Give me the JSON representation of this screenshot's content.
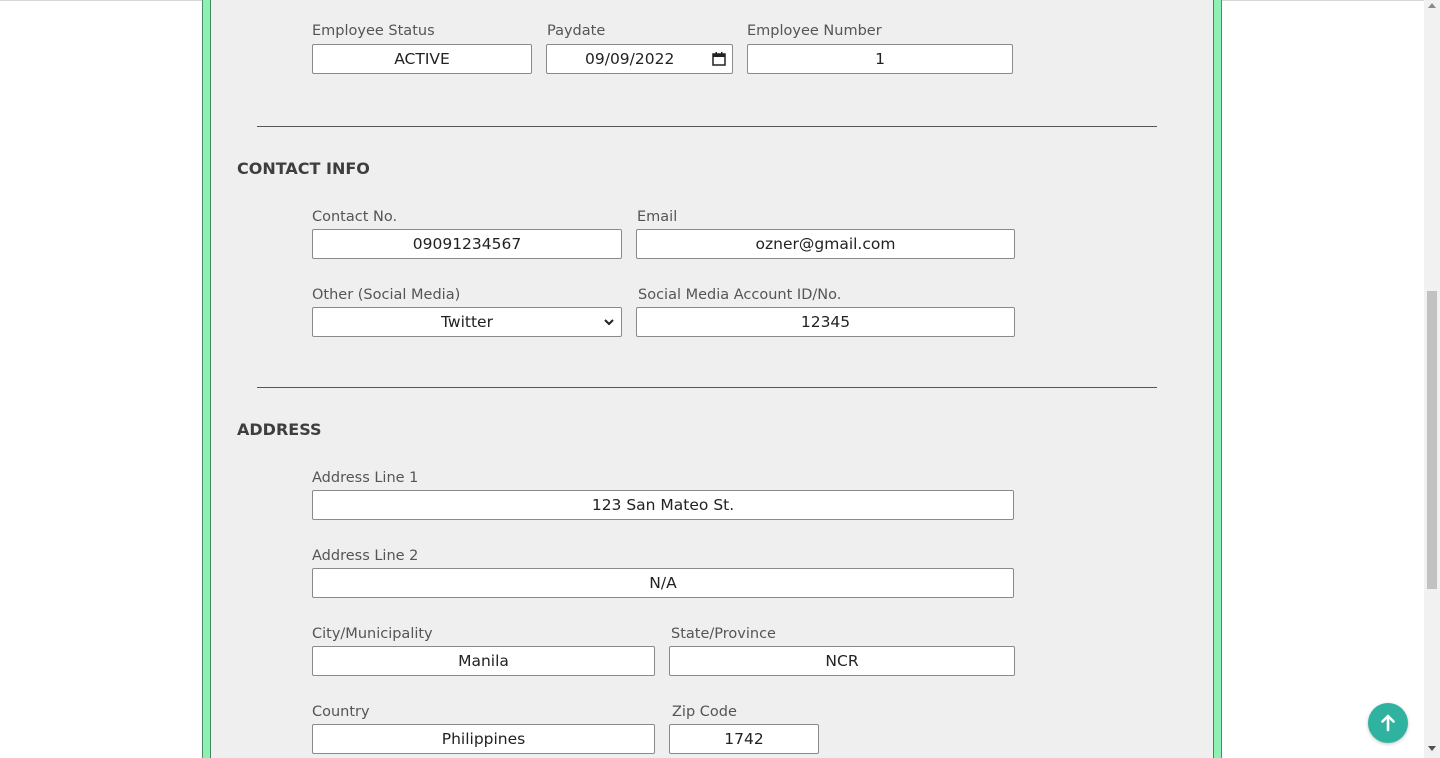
{
  "employment": {
    "employee_status": {
      "label": "Employee Status",
      "value": "ACTIVE"
    },
    "paydate": {
      "label": "Paydate",
      "value": "09/09/2022"
    },
    "employee_number": {
      "label": "Employee Number",
      "value": "1"
    }
  },
  "contact_info": {
    "title": "CONTACT INFO",
    "contact_no": {
      "label": "Contact No.",
      "value": "09091234567"
    },
    "email": {
      "label": "Email",
      "value": "ozner@gmail.com"
    },
    "other_social": {
      "label": "Other (Social Media)",
      "value": "Twitter"
    },
    "social_id": {
      "label": "Social Media Account ID/No.",
      "value": "12345"
    }
  },
  "address": {
    "title": "ADDRESS",
    "line1": {
      "label": "Address Line 1",
      "value": "123 San Mateo St."
    },
    "line2": {
      "label": "Address Line 2",
      "value": "N/A"
    },
    "city": {
      "label": "City/Municipality",
      "value": "Manila"
    },
    "state": {
      "label": "State/Province",
      "value": "NCR"
    },
    "country": {
      "label": "Country",
      "value": "Philippines"
    },
    "zip": {
      "label": "Zip Code",
      "value": "1742"
    }
  },
  "colors": {
    "panel_border": "#8ff0b6",
    "panel_background": "#efefef",
    "back_to_top": "#2fb3a0"
  },
  "icons": {
    "calendar": "calendar-icon",
    "select_chevron": "chevron-down-icon",
    "back_to_top": "arrow-up-icon"
  }
}
